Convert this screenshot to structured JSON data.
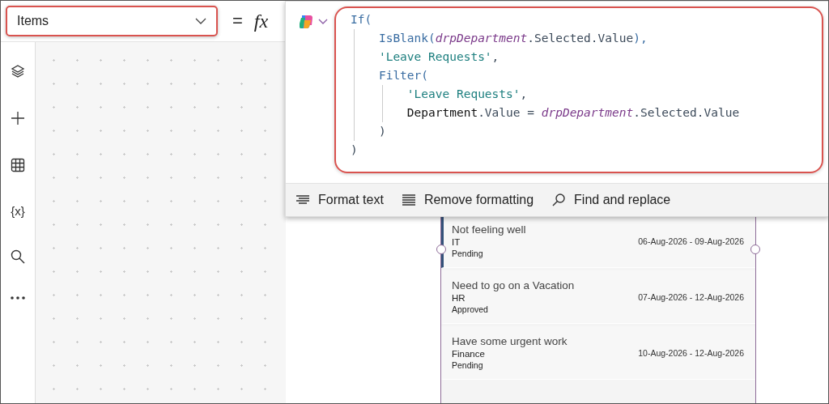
{
  "property_dropdown": {
    "value": "Items"
  },
  "formula_bar": {
    "equals": "=",
    "fx": "fx",
    "code_lines": [
      [
        {
          "kind": "function",
          "text": "If("
        }
      ],
      [
        {
          "kind": "function",
          "text": "    IsBlank("
        },
        {
          "kind": "variable",
          "text": "drpDepartment"
        },
        {
          "kind": "member",
          "text": ".Selected.Value"
        },
        {
          "kind": "function",
          "text": "),"
        }
      ],
      [
        {
          "kind": "string",
          "text": "    'Leave Requests'"
        },
        {
          "kind": "member",
          "text": ","
        }
      ],
      [
        {
          "kind": "function",
          "text": "    Filter("
        }
      ],
      [
        {
          "kind": "string",
          "text": "        'Leave Requests'"
        },
        {
          "kind": "member",
          "text": ","
        }
      ],
      [
        {
          "kind": "plain",
          "text": "        Department"
        },
        {
          "kind": "member",
          "text": ".Value = "
        },
        {
          "kind": "variable",
          "text": "drpDepartment"
        },
        {
          "kind": "member",
          "text": ".Selected.Value"
        }
      ],
      [
        {
          "kind": "member",
          "text": "    )"
        }
      ],
      [
        {
          "kind": "member",
          "text": ")"
        }
      ]
    ],
    "toolbar": [
      {
        "kind": "format",
        "label": "Format text"
      },
      {
        "kind": "remove",
        "label": "Remove formatting"
      },
      {
        "kind": "find",
        "label": "Find and replace"
      }
    ]
  },
  "left_rail": [
    {
      "kind": "layers"
    },
    {
      "kind": "add"
    },
    {
      "kind": "table"
    },
    {
      "kind": "variables",
      "text": "{x}"
    },
    {
      "kind": "search"
    },
    {
      "kind": "more"
    }
  ],
  "gallery": {
    "rows": [
      {
        "title": "Not feeling well",
        "department": "IT",
        "status": "Pending",
        "dates": "06-Aug-2026 - 09-Aug-2026",
        "selected": true
      },
      {
        "title": "Need to go on a Vacation",
        "department": "HR",
        "status": "Approved",
        "dates": "07-Aug-2026 - 12-Aug-2026",
        "selected": false
      },
      {
        "title": "Have some urgent work",
        "department": "Finance",
        "status": "Pending",
        "dates": "10-Aug-2026 - 12-Aug-2026",
        "selected": false
      }
    ]
  }
}
